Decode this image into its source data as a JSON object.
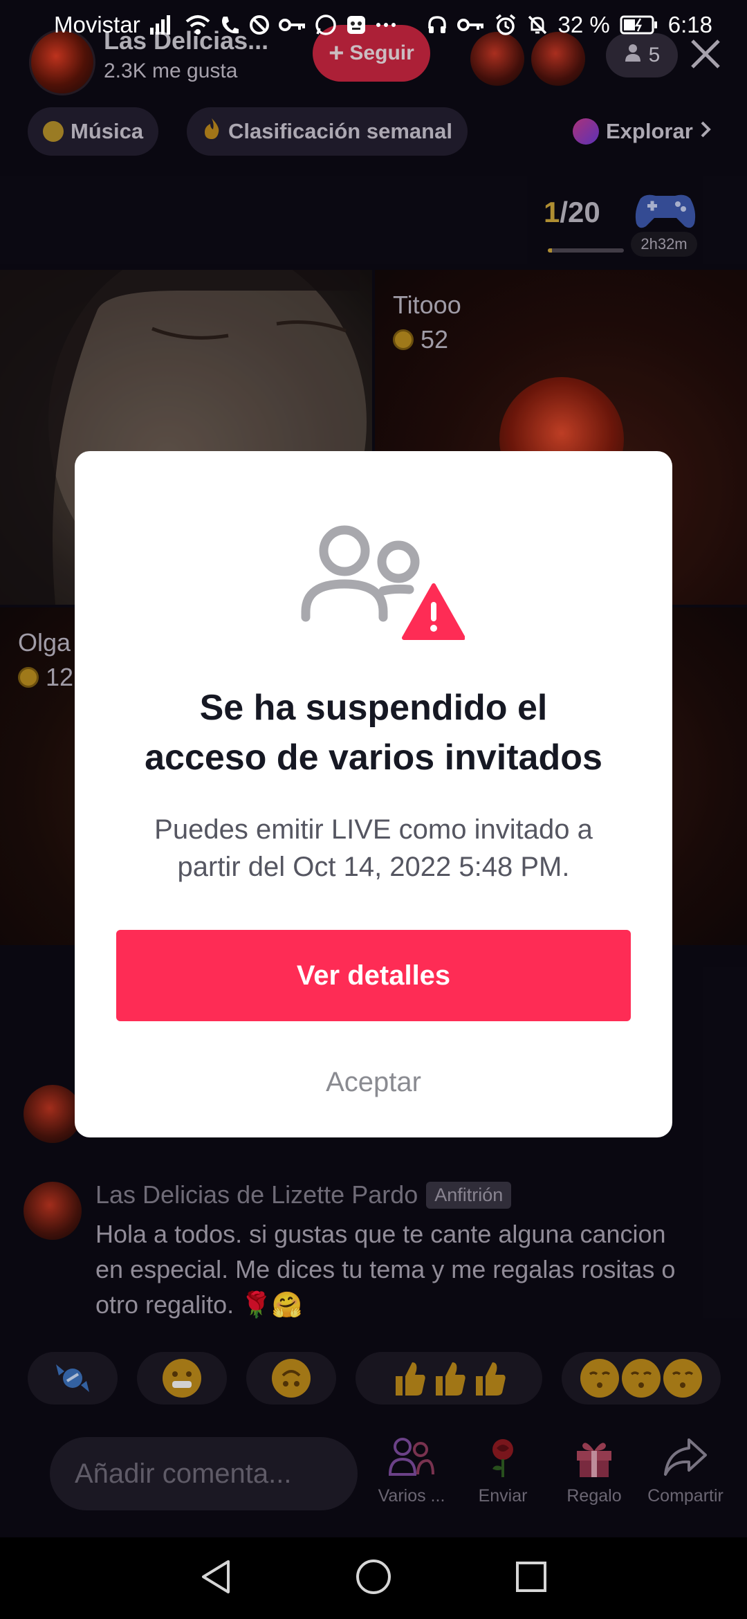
{
  "status_bar": {
    "carrier": "Movistar",
    "battery_percent": "32 %",
    "time": "6:18"
  },
  "header": {
    "host_name": "Las Delicias...",
    "likes": "2.3K me gusta",
    "follow_label": "Seguir",
    "viewer_count": "5"
  },
  "chips": {
    "music": "Música",
    "weekly_ranking": "Clasificación semanal",
    "explore": "Explorar"
  },
  "room": {
    "page_current": "1",
    "page_total": "/20",
    "page_progress": 0.05,
    "game_timer": "2h32m"
  },
  "guests": [
    {
      "name": "",
      "coins": ""
    },
    {
      "name": "Titooo",
      "coins": "52"
    },
    {
      "name": "Olga",
      "coins": "12"
    }
  ],
  "chat": {
    "user": "Las Delicias de Lizette Pardo",
    "badge": "Anfitrión",
    "message": "Hola a  todos. si gustas que te cante alguna cancion en especial. Me dices tu tema y me regalas rositas o otro regalito. 🌹🤗"
  },
  "bottom": {
    "comment_placeholder": "Añadir comenta...",
    "multi_guest_label": "Varios ...",
    "send_label": "Enviar",
    "gift_label": "Regalo",
    "share_label": "Compartir"
  },
  "modal": {
    "title_line1": "Se ha suspendido el",
    "title_line2": "acceso de varios invitados",
    "body_line1": "Puedes emitir LIVE como invitado a",
    "body_line2": "partir del Oct 14, 2022 5:48 PM.",
    "primary_button": "Ver detalles",
    "secondary_button": "Aceptar"
  },
  "colors": {
    "accent": "#fe2c55",
    "warning": "#fe2c55",
    "coin": "#b58a1e"
  }
}
